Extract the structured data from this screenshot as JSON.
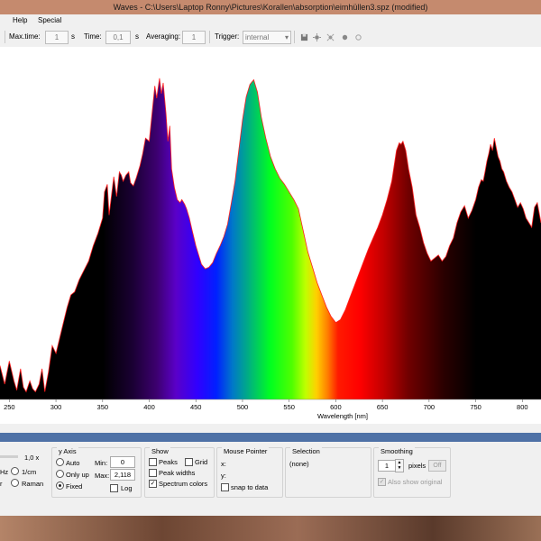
{
  "window": {
    "title": "Waves  -  C:\\Users\\Laptop Ronny\\Pictures\\Korallen\\absorption\\eimhüllen3.spz  (modified)"
  },
  "menu": [
    "Help",
    "Special"
  ],
  "toolbar": {
    "max_time_label": "Max.time:",
    "max_time_value": "1",
    "max_time_unit": "s",
    "time_label": "Time:",
    "time_value": "0,1",
    "time_unit": "s",
    "averaging_label": "Averaging:",
    "averaging_value": "1",
    "trigger_label": "Trigger:",
    "trigger_value": "internal",
    "icons": [
      "save-icon",
      "bright-icon",
      "dim-icon",
      "record-icon",
      "stop-icon"
    ]
  },
  "chart_data": {
    "type": "area",
    "xlabel": "Wavelength [nm]",
    "xlim": [
      240,
      820
    ],
    "x_ticks": [
      250,
      300,
      350,
      400,
      450,
      500,
      550,
      600,
      650,
      700,
      750,
      800
    ],
    "ylim": [
      0,
      2.118
    ],
    "fill": "spectrum colors",
    "outline_color": "#ff2020",
    "x": [
      240,
      245,
      250,
      255,
      258,
      262,
      265,
      268,
      272,
      275,
      278,
      282,
      285,
      288,
      292,
      296,
      300,
      304,
      308,
      312,
      316,
      320,
      325,
      330,
      335,
      340,
      345,
      350,
      352,
      355,
      357,
      360,
      362,
      365,
      368,
      370,
      372,
      375,
      378,
      380,
      383,
      386,
      390,
      393,
      396,
      400,
      403,
      406,
      408,
      411,
      413,
      415,
      418,
      420,
      422,
      424,
      427,
      430,
      433,
      435,
      438,
      440,
      443,
      446,
      450,
      453,
      456,
      460,
      464,
      468,
      472,
      476,
      480,
      484,
      488,
      492,
      496,
      500,
      504,
      508,
      512,
      516,
      520,
      525,
      530,
      535,
      540,
      545,
      550,
      555,
      560,
      565,
      570,
      575,
      580,
      585,
      590,
      595,
      600,
      605,
      610,
      615,
      620,
      625,
      630,
      635,
      640,
      645,
      650,
      655,
      660,
      665,
      668,
      670,
      672,
      675,
      678,
      682,
      686,
      690,
      694,
      698,
      702,
      706,
      710,
      714,
      718,
      722,
      726,
      730,
      734,
      738,
      742,
      746,
      750,
      753,
      756,
      758,
      760,
      762,
      764,
      766,
      768,
      770,
      772,
      774,
      776,
      778,
      780,
      783,
      786,
      789,
      792,
      795,
      798,
      801,
      804,
      807,
      810,
      813,
      816,
      820
    ],
    "values": [
      0.22,
      0.1,
      0.25,
      0.12,
      0.06,
      0.2,
      0.08,
      0.05,
      0.12,
      0.07,
      0.05,
      0.1,
      0.2,
      0.05,
      0.18,
      0.35,
      0.3,
      0.4,
      0.5,
      0.6,
      0.68,
      0.7,
      0.78,
      0.84,
      0.9,
      1.0,
      1.08,
      1.18,
      1.35,
      1.4,
      1.2,
      1.35,
      1.45,
      1.32,
      1.48,
      1.46,
      1.42,
      1.46,
      1.48,
      1.41,
      1.39,
      1.44,
      1.52,
      1.6,
      1.7,
      1.68,
      1.86,
      2.04,
      1.96,
      2.09,
      1.99,
      2.06,
      1.86,
      1.68,
      1.78,
      1.5,
      1.38,
      1.3,
      1.28,
      1.3,
      1.27,
      1.24,
      1.18,
      1.1,
      1.0,
      0.94,
      0.88,
      0.85,
      0.86,
      0.89,
      0.95,
      1.0,
      1.06,
      1.14,
      1.28,
      1.42,
      1.62,
      1.82,
      1.97,
      2.05,
      2.08,
      2.0,
      1.84,
      1.7,
      1.58,
      1.5,
      1.44,
      1.4,
      1.35,
      1.3,
      1.24,
      1.1,
      0.96,
      0.86,
      0.76,
      0.68,
      0.6,
      0.54,
      0.5,
      0.52,
      0.58,
      0.66,
      0.74,
      0.82,
      0.9,
      0.98,
      1.05,
      1.12,
      1.2,
      1.3,
      1.42,
      1.62,
      1.67,
      1.66,
      1.68,
      1.62,
      1.5,
      1.38,
      1.2,
      1.12,
      1.02,
      0.95,
      0.9,
      0.92,
      0.94,
      0.9,
      0.93,
      1.0,
      1.05,
      1.15,
      1.22,
      1.26,
      1.18,
      1.23,
      1.3,
      1.38,
      1.43,
      1.42,
      1.48,
      1.55,
      1.6,
      1.66,
      1.62,
      1.7,
      1.64,
      1.58,
      1.55,
      1.5,
      1.48,
      1.42,
      1.38,
      1.35,
      1.3,
      1.25,
      1.28,
      1.24,
      1.18,
      1.15,
      1.12,
      1.25,
      1.28,
      1.15,
      1.1,
      1.2,
      1.25,
      1.18
    ]
  },
  "panel": {
    "zoom_value": "1,0 x",
    "unit_hz_label": "Hz",
    "unit_cm_label": "1/cm",
    "unit_raman_label": "Raman",
    "y_axis": {
      "title": "y Axis",
      "auto": "Auto",
      "only_up": "Only up",
      "fixed": "Fixed",
      "min_label": "Min:",
      "min_value": "0",
      "max_label": "Max:",
      "max_value": "2,118",
      "log": "Log"
    },
    "show": {
      "title": "Show",
      "peaks": "Peaks",
      "grid": "Grid",
      "peak_widths": "Peak widths",
      "spectrum_colors": "Spectrum colors"
    },
    "pointer": {
      "title": "Mouse Pointer",
      "x": "x:",
      "y": "y:",
      "snap": "snap to data"
    },
    "selection": {
      "title": "Selection",
      "value": "(none)"
    },
    "smoothing": {
      "title": "Smoothing",
      "value": "1",
      "unit": "pixels",
      "off": "Off",
      "also_show": "Also show original"
    }
  }
}
